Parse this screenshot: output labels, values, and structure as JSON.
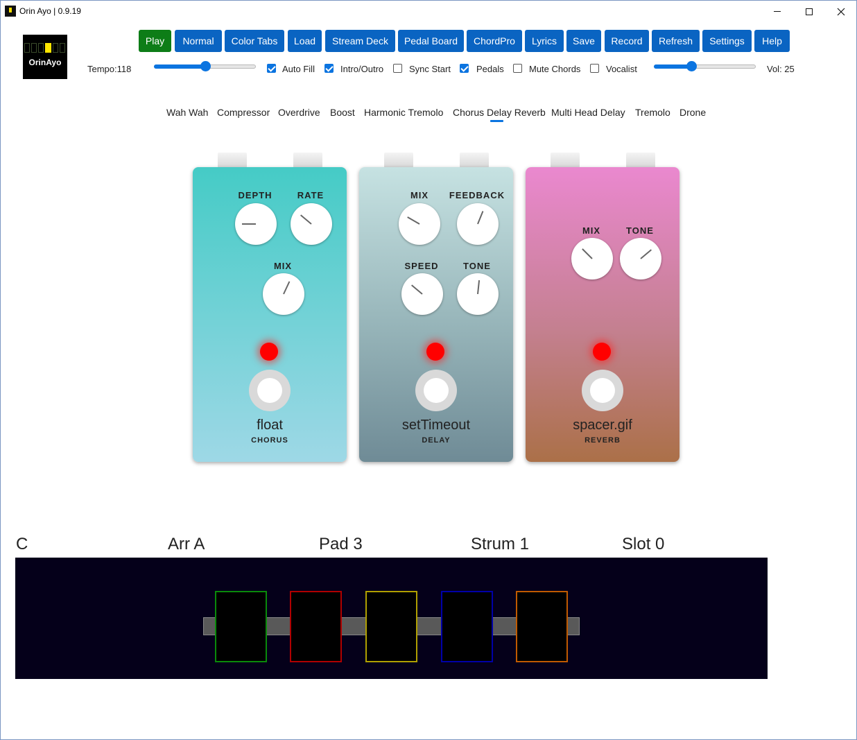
{
  "window": {
    "title": "Orin Ayo | 0.9.19"
  },
  "logo": {
    "text": "OrinAyo"
  },
  "toolbar": {
    "buttons": [
      "Play",
      "Normal",
      "Color Tabs",
      "Load",
      "Stream Deck",
      "Pedal Board",
      "ChordPro",
      "Lyrics",
      "Save",
      "Record",
      "Refresh",
      "Settings",
      "Help"
    ]
  },
  "controls": {
    "tempo_label": "Tempo:118",
    "tempo_value": 118,
    "volume_label": "Vol: 25",
    "volume_value": 25,
    "options": [
      {
        "label": "Auto Fill",
        "checked": true
      },
      {
        "label": "Intro/Outro",
        "checked": true
      },
      {
        "label": "Sync Start",
        "checked": false
      },
      {
        "label": "Pedals",
        "checked": true
      },
      {
        "label": "Mute Chords",
        "checked": false
      },
      {
        "label": "Vocalist",
        "checked": false
      }
    ]
  },
  "tabs": {
    "items": [
      "Wah Wah",
      "Compressor",
      "Overdrive",
      "Boost",
      "Harmonic Tremolo",
      "Chorus Delay Reverb",
      "Multi Head Delay",
      "Tremolo",
      "Drone"
    ],
    "active": "Chorus Delay Reverb"
  },
  "pedals": [
    {
      "name": "float",
      "type": "CHORUS",
      "knobs": [
        "DEPTH",
        "RATE",
        "MIX"
      ]
    },
    {
      "name": "setTimeout",
      "type": "DELAY",
      "knobs": [
        "MIX",
        "FEEDBACK",
        "SPEED",
        "TONE"
      ]
    },
    {
      "name": "spacer.gif",
      "type": "REVERB",
      "knobs": [
        "MIX",
        "TONE"
      ]
    }
  ],
  "status": {
    "chord": "C",
    "arrangement": "Arr A",
    "pad": "Pad 3",
    "strum": "Strum 1",
    "slot": "Slot 0"
  },
  "pad_colors": [
    "#0a8a0a",
    "#b00000",
    "#b0a000",
    "#0000a8",
    "#c05a00"
  ]
}
